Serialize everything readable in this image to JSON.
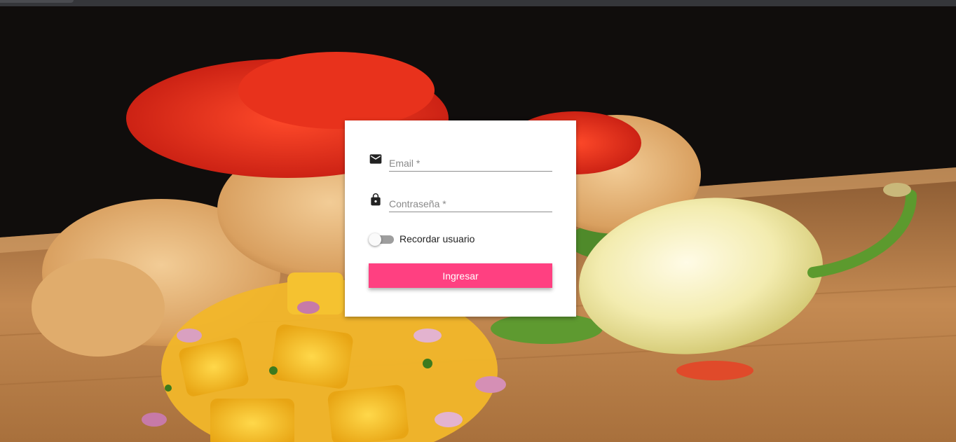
{
  "login": {
    "email_placeholder": "Email *",
    "password_placeholder": "Contraseña *",
    "remember_label": "Recordar usuario",
    "remember_checked": false,
    "submit_label": "Ingresar"
  },
  "background": {
    "description_icon": "food-photo"
  },
  "colors": {
    "accent": "#ff4081",
    "card": "#ffffff",
    "toggle_off": "#9e9e9e"
  }
}
